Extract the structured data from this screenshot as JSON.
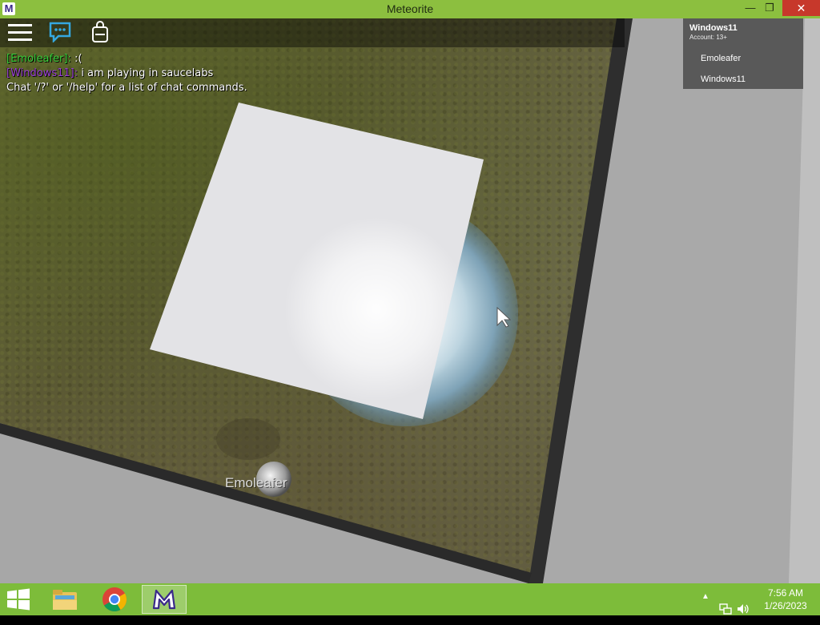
{
  "window": {
    "title": "Meteorite",
    "icon_letter": "M",
    "minimize_symbol": "—",
    "maximize_symbol": "❐",
    "close_symbol": "✕"
  },
  "topbar": {
    "icons": [
      "menu-icon",
      "chat-icon",
      "backpack-icon"
    ]
  },
  "chat": {
    "messages": [
      {
        "name": "[Emoleafer]:",
        "text": ":(",
        "name_color": "#3bd33b"
      },
      {
        "name": "[Windows11]:",
        "text": "i am playing in saucelabs",
        "name_color": "#9b3fd6"
      }
    ],
    "system": "Chat '/?' or '/help' for a list of chat commands."
  },
  "leaderboard": {
    "username": "Windows11",
    "account": "Account: 13+",
    "players": [
      "Emoleafer",
      "Windows11"
    ]
  },
  "world": {
    "player_nameplate": "Emoleafer"
  },
  "taskbar": {
    "apps": [
      "file-explorer",
      "chrome",
      "meteorite"
    ],
    "tray_arrow": "▲",
    "time": "7:56 AM",
    "date": "1/26/2023"
  },
  "colors": {
    "titlebar": "#8cbf3f",
    "taskbar": "#7dbc3a",
    "close_button": "#c7382b"
  }
}
